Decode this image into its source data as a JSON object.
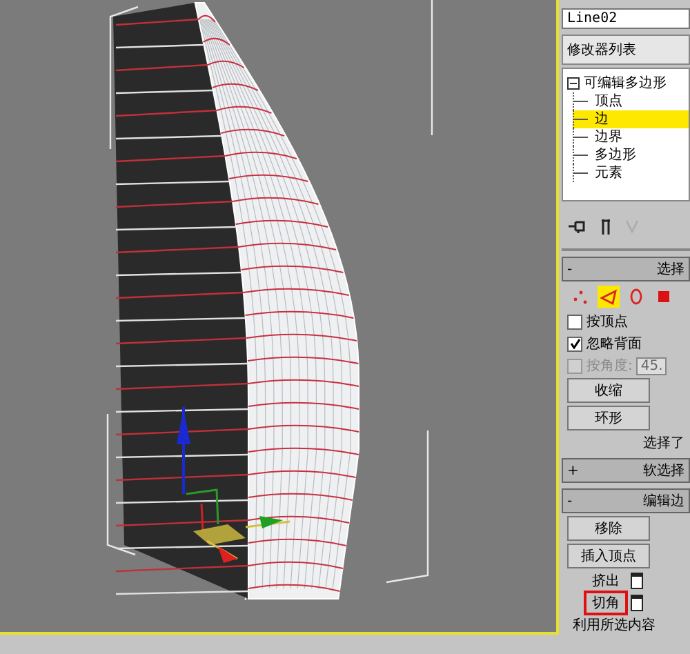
{
  "object_name": "Line02",
  "modifier_list": "修改器列表",
  "modifier_stack": [
    {
      "label": "可编辑多边形",
      "expanded": true,
      "children": [
        {
          "label": "顶点",
          "selected": false
        },
        {
          "label": "边",
          "selected": true
        },
        {
          "label": "边界",
          "selected": false
        },
        {
          "label": "多边形",
          "selected": false
        },
        {
          "label": "元素",
          "selected": false
        }
      ]
    }
  ],
  "selection_rollout": {
    "toggle": "-",
    "title": "选择",
    "subobject_modes": [
      {
        "kind": "vertex",
        "selected": false
      },
      {
        "kind": "edge",
        "selected": true
      },
      {
        "kind": "border",
        "selected": false
      },
      {
        "kind": "polygon",
        "selected": false
      }
    ],
    "options": [
      {
        "label": "按顶点",
        "checked": false,
        "disabled": false
      },
      {
        "label": "忽略背面",
        "checked": true,
        "disabled": false
      },
      {
        "label": "按角度:",
        "checked": false,
        "disabled": true,
        "value": "45."
      }
    ],
    "buttons": [
      "收缩",
      "环形"
    ],
    "status": "选择了"
  },
  "soft_selection_rollout": {
    "toggle": "+",
    "title": "软选择"
  },
  "edit_edges_rollout": {
    "toggle": "-",
    "title": "编辑边",
    "buttons": [
      {
        "label": "移除",
        "has_settings": false,
        "highlighted": false
      },
      {
        "label": "插入顶点",
        "has_settings": false,
        "highlighted": false
      },
      {
        "label": "挤出",
        "has_settings": true,
        "highlighted": false
      },
      {
        "label": "切角",
        "has_settings": true,
        "highlighted": true
      }
    ],
    "footer": "利用所选内容"
  }
}
